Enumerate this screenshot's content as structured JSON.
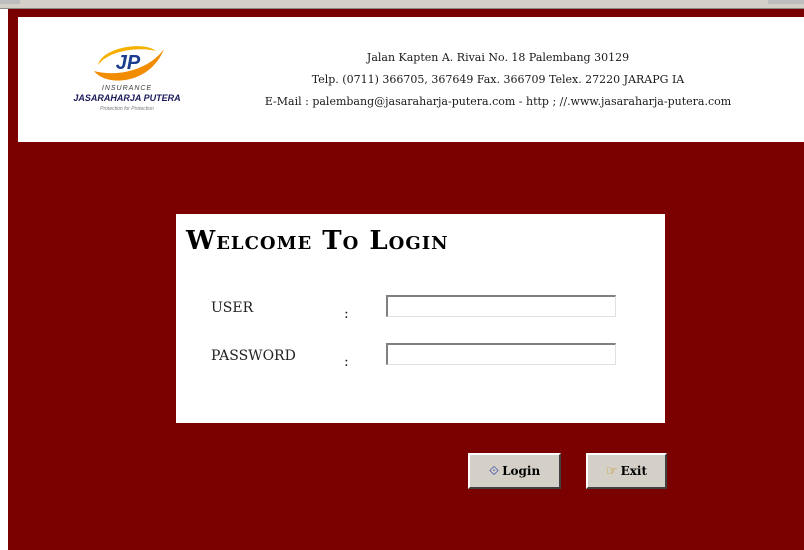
{
  "header": {
    "logo": {
      "monogram": "JP",
      "insurance_text": "INSURANCE",
      "company_name": "JASARAHARJA PUTERA",
      "tagline": "Protection for Protection",
      "colors": {
        "swoosh": "#f28c00",
        "monogram": "#1a3d8f"
      }
    },
    "address_line1": "Jalan Kapten A. Rivai No. 18 Palembang 30129",
    "address_line2": "Telp. (0711) 366705, 367649 Fax. 366709 Telex. 27220 JARAPG IA",
    "address_line3": "E-Mail : palembang@jasaraharja-putera.com  -  http ; //.www.jasaraharja-putera.com"
  },
  "login": {
    "title": "Welcome To Login",
    "user_label": "USER",
    "password_label": "PASSWORD",
    "colon": ":",
    "user_value": "",
    "password_value": ""
  },
  "buttons": {
    "login_label": "Login",
    "login_icon": "key-icon",
    "exit_label": "Exit",
    "exit_icon": "pointing-hand-icon"
  },
  "colors": {
    "background": "#7b0000",
    "panel": "#ffffff",
    "button_face": "#d4d0c8"
  }
}
